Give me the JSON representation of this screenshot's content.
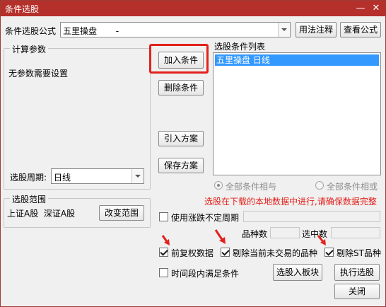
{
  "window": {
    "title": "条件选股",
    "minimize": "—",
    "close": "✕"
  },
  "formula": {
    "label": "条件选股公式",
    "value": "五里操盘       -",
    "usage_button": "用法注释",
    "view_button": "查看公式"
  },
  "params": {
    "legend": "计算参数",
    "message": "无参数需要设置",
    "period_label": "选股周期:",
    "period_value": "日线"
  },
  "actions": {
    "add": "加入条件",
    "delete": "删除条件",
    "import": "引入方案",
    "save": "保存方案"
  },
  "conditions": {
    "label": "选股条件列表",
    "items": [
      "五里操盘   日线"
    ]
  },
  "logic": {
    "and_label": "全部条件相与",
    "or_label": "全部条件相或"
  },
  "notice": "选股在下载的本地数据中进行,请确保数据完整",
  "range": {
    "legend": "选股范围",
    "value": "上证A股  深证A股",
    "change_button": "改变范围"
  },
  "options": {
    "limit_period": "使用涨跌不定周期",
    "stock_count_label": "品种数",
    "selected_count_label": "选中数",
    "pre_adjust": "前复权数据",
    "exclude_untraded": "剔除当前未交易的品种",
    "exclude_st": "剔除ST品种",
    "time_range": "时间段内满足条件"
  },
  "bottom": {
    "to_block": "选股入板块",
    "execute": "执行选股",
    "close": "关闭"
  },
  "colors": {
    "title_bar": "#b5302b",
    "highlight": "#e3211c",
    "selection": "#3399ff"
  }
}
